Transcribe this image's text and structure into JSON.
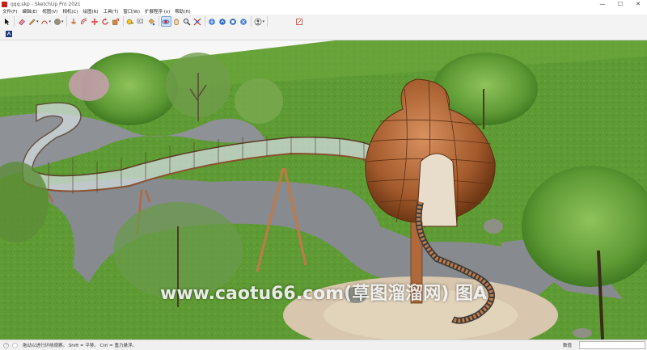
{
  "window": {
    "title": "qqq.skp - SketchUp Pro 2021",
    "controls": [
      "—",
      "☐",
      "✕"
    ]
  },
  "menu": [
    "文件(F)",
    "编辑(E)",
    "视图(V)",
    "相机(C)",
    "绘图(R)",
    "工具(T)",
    "窗口(W)",
    "扩展程序 (x)",
    "帮助(H)"
  ],
  "toolbar": {
    "tools": [
      {
        "name": "select",
        "icon": "cursor-arrow"
      },
      {
        "name": "eraser",
        "icon": "eraser"
      },
      {
        "name": "line",
        "icon": "pencil"
      },
      {
        "name": "arc",
        "icon": "arc"
      },
      {
        "name": "shape",
        "icon": "circle-shape"
      },
      {
        "name": "push-pull",
        "icon": "push-pull"
      },
      {
        "name": "offset",
        "icon": "offset"
      },
      {
        "name": "move",
        "icon": "move"
      },
      {
        "name": "rotate",
        "icon": "rotate"
      },
      {
        "name": "scale",
        "icon": "scale"
      },
      {
        "name": "paint",
        "icon": "paint-bucket"
      },
      {
        "name": "tape",
        "icon": "tape-measure"
      },
      {
        "name": "text",
        "icon": "text"
      },
      {
        "name": "paint-2",
        "icon": "paint"
      },
      {
        "name": "orbit",
        "icon": "orbit"
      },
      {
        "name": "pan",
        "icon": "hand"
      },
      {
        "name": "zoom",
        "icon": "magnifier"
      },
      {
        "name": "zoom-extents",
        "icon": "zoom-extents"
      },
      {
        "name": "warehouse",
        "icon": "warehouse"
      },
      {
        "name": "share",
        "icon": "share"
      },
      {
        "name": "extension",
        "icon": "extension"
      },
      {
        "name": "account",
        "icon": "account"
      },
      {
        "name": "layout",
        "icon": "send-to-layout"
      }
    ]
  },
  "status": {
    "hint": "拖动以进行环绕观察。 Shift = 平移。 Ctrl = 重力悬浮。",
    "measure_label": "数值",
    "measure_value": ""
  },
  "watermark": "www.caotu66.com(草图溜溜网) 图A",
  "colors": {
    "grass": "#5f9b34",
    "path": "#8b8e92",
    "wood": "#b0693b",
    "sky": "#f6f6f6"
  }
}
